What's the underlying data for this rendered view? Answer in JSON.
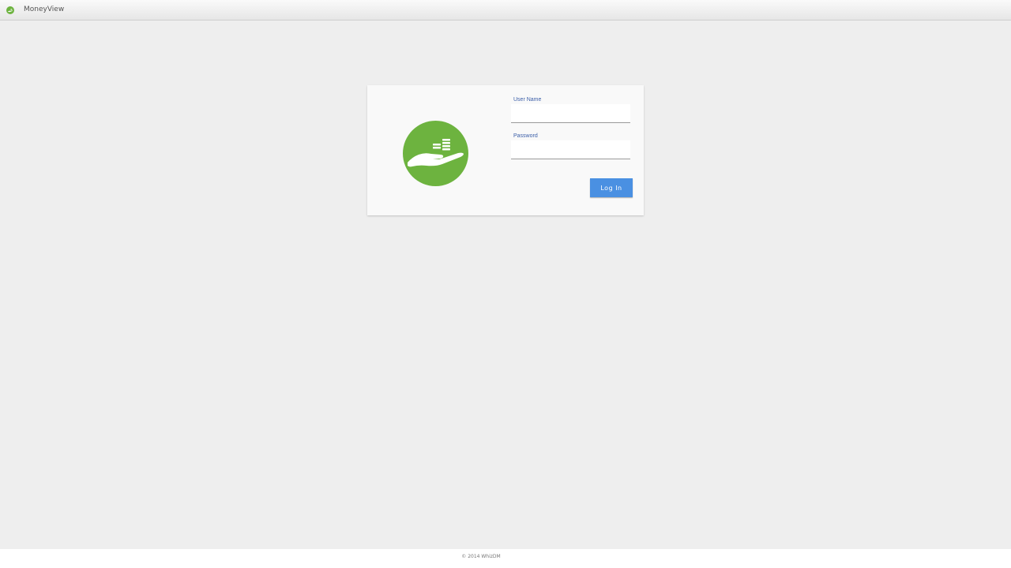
{
  "window": {
    "title": "MoneyView",
    "icon": "moneyview-app-icon"
  },
  "login": {
    "logo_icon": "hand-holding-coins-icon",
    "username_label": "User Name",
    "username_value": "",
    "password_label": "Password",
    "password_value": "",
    "login_button_label": "Log In"
  },
  "footer": {
    "copyright": "© 2014 WhizDM"
  },
  "colors": {
    "brand_green": "#6db33f",
    "button_blue": "#4a90e2",
    "label_blue": "#3b5ea8",
    "background": "#eeeeee",
    "card": "#f9f9f9"
  }
}
